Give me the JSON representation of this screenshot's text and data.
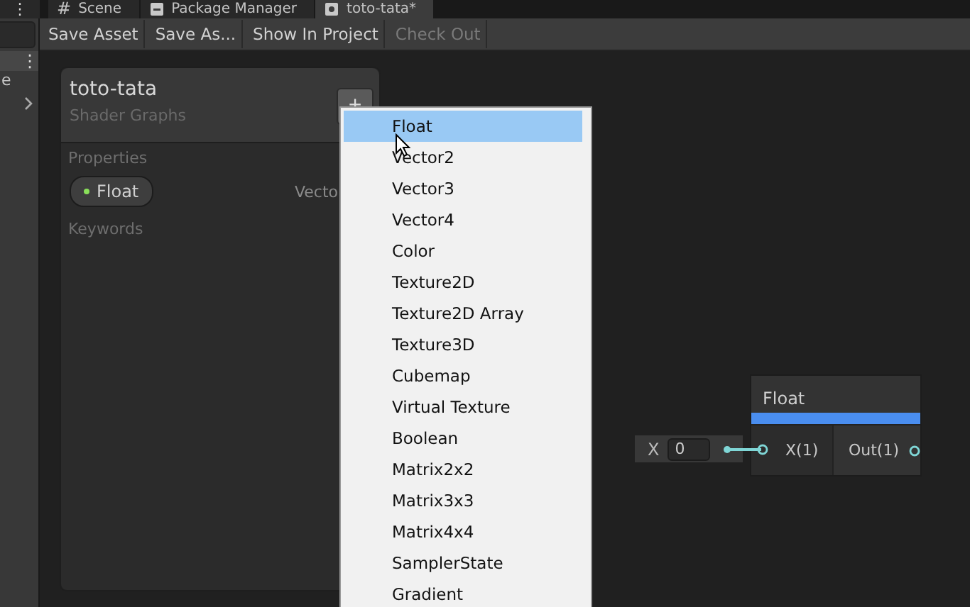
{
  "tabs": [
    {
      "label": "Scene",
      "icon": "#",
      "selected": false
    },
    {
      "label": "Package Manager",
      "selected": false
    },
    {
      "label": "toto-tata*",
      "selected": true
    }
  ],
  "side_panel": {
    "menu_glyph": "⋮",
    "header_glyph": "⋮",
    "item": "e"
  },
  "toolbar": [
    {
      "label": "Save Asset",
      "disabled": false
    },
    {
      "label": "Save As...",
      "disabled": false
    },
    {
      "label": "Show In Project",
      "disabled": false
    },
    {
      "label": "Check Out",
      "disabled": true
    }
  ],
  "blackboard": {
    "title": "toto-tata",
    "subtitle": "Shader Graphs",
    "add_glyph": "+",
    "section": "Properties",
    "properties": [
      {
        "name": "Float",
        "color": "#8ae05a"
      }
    ],
    "property_type": "Vecto",
    "keywords_label": "Keywords"
  },
  "menu": [
    {
      "label": "Float",
      "selected": true
    },
    {
      "label": "Vector2",
      "selected": false
    },
    {
      "label": "Vector3",
      "selected": false
    },
    {
      "label": "Vector4",
      "selected": false
    },
    {
      "label": "Color",
      "selected": false
    },
    {
      "label": "Texture2D",
      "selected": false
    },
    {
      "label": "Texture2D Array",
      "selected": false
    },
    {
      "label": "Texture3D",
      "selected": false
    },
    {
      "label": "Cubemap",
      "selected": false
    },
    {
      "label": "Virtual Texture",
      "selected": false
    },
    {
      "label": "Boolean",
      "selected": false
    },
    {
      "label": "Matrix2x2",
      "selected": false
    },
    {
      "label": "Matrix3x3",
      "selected": false
    },
    {
      "label": "Matrix4x4",
      "selected": false
    },
    {
      "label": "SamplerState",
      "selected": false
    },
    {
      "label": "Gradient",
      "selected": false
    }
  ],
  "node": {
    "title": "Float",
    "input_label": "X",
    "input_value": "0",
    "in_port": "X(1)",
    "out_port": "Out(1)"
  }
}
